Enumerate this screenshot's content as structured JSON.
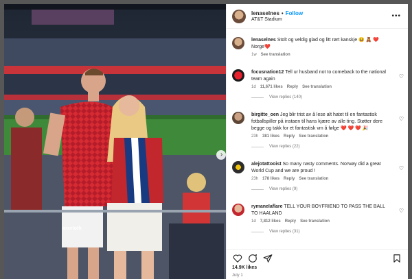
{
  "post": {
    "username": "lenaselnes",
    "follow_label": "Follow",
    "location": "AT&T Stadium",
    "caption_username": "lenaselnes",
    "caption_text": "Stolt og veldig glad og litt rørt kanskje 😆 🧸 ❤️ Norge❤️",
    "caption_time": "1w",
    "see_translation": "See translation",
    "shirt_text": "asurloth",
    "likes": "14.9K likes",
    "date": "July 1"
  },
  "comments": [
    {
      "username": "focusnation12",
      "text": "Tell ur husband not to comeback to the national team again",
      "time": "1d",
      "likes": "11,671 likes",
      "reply": "Reply",
      "translate": "See translation",
      "replies": "View replies (140)"
    },
    {
      "username": "birgitte_oen",
      "text": "Jeg blir trist av å lese alt hatet til en fantastisk fotballspiller på instaen til hans kjære av alle ting. Støtter dere begge og takk for et fantastisk vm å følge ❤️ ❤️ ❤️ 🎉",
      "time": "23h",
      "likes": "381 likes",
      "reply": "Reply",
      "translate": "See translation",
      "replies": "View replies (22)"
    },
    {
      "username": "alejotattooist",
      "text": "So many nasty comments. Norway did a great World Cup and we are proud !",
      "time": "23h",
      "likes": "178 likes",
      "reply": "Reply",
      "translate": "See translation",
      "replies": "View replies (9)"
    },
    {
      "username": "rymaneIaflare",
      "text": "TELL YOUR BOYFRIEND TO PASS THE BALL TO HAALAND",
      "time": "1d",
      "likes": "7,812 likes",
      "reply": "Reply",
      "translate": "See translation",
      "replies": "View replies (31)"
    }
  ],
  "icons": {
    "like": "heart-icon",
    "comment": "comment-icon",
    "share": "share-icon",
    "save": "bookmark-icon",
    "more": "more-options-icon",
    "next": "chevron-right-icon"
  },
  "colors": {
    "accent": "#0095f6",
    "text": "#262626",
    "muted": "#737373"
  }
}
